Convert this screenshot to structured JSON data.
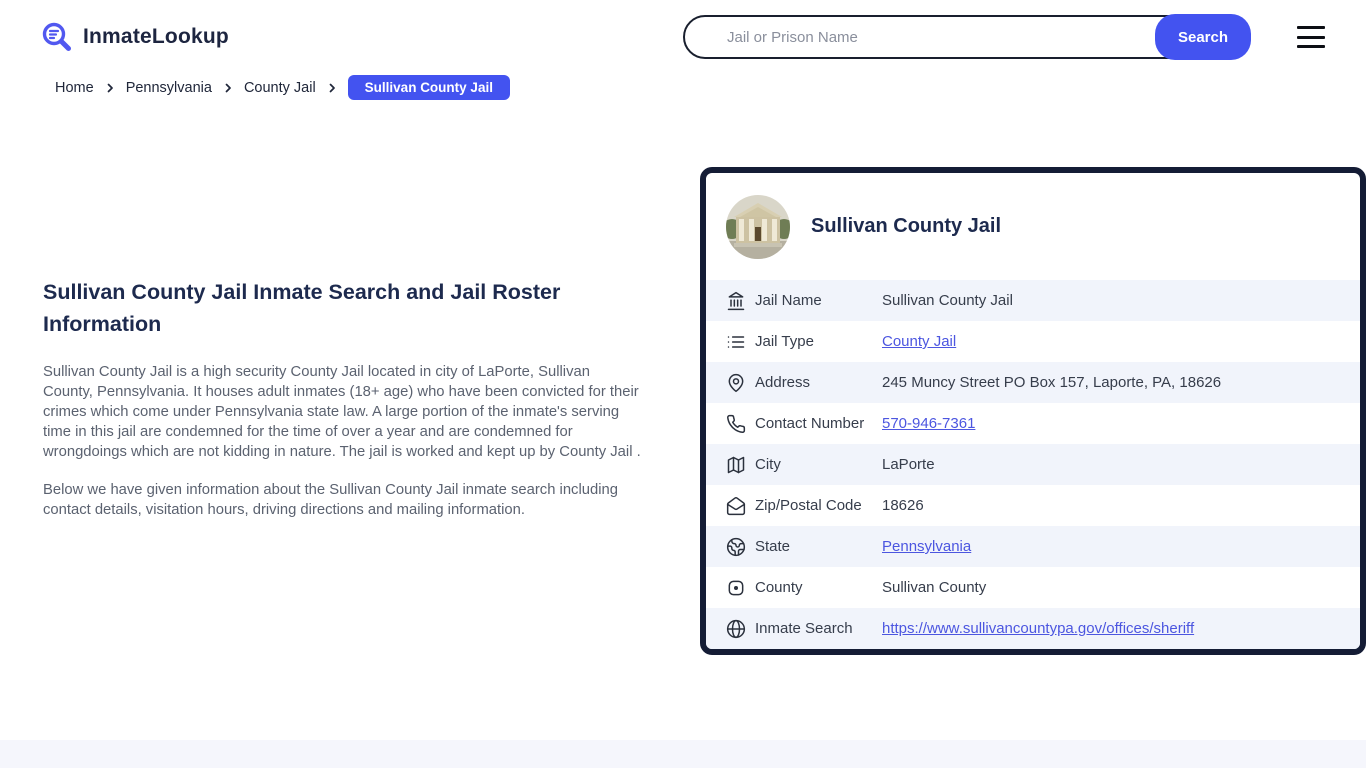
{
  "header": {
    "logo_text": "InmateLookup",
    "search": {
      "placeholder": "Jail or Prison Name",
      "button_label": "Search"
    }
  },
  "breadcrumb": {
    "items": [
      "Home",
      "Pennsylvania",
      "County Jail"
    ],
    "current": "Sullivan County Jail"
  },
  "article": {
    "title": "Sullivan County Jail Inmate Search and Jail Roster Information",
    "paragraphs": [
      "Sullivan County Jail is a high security County Jail located in city of LaPorte, Sullivan County, Pennsylvania. It houses adult inmates (18+ age) who have been convicted for their crimes which come under Pennsylvania state law. A large portion of the inmate's serving time in this jail are condemned for the time of over a year and are condemned for wrongdoings which are not kidding in nature. The jail is worked and kept up by County Jail .",
      "Below we have given information about the Sullivan County Jail inmate search including contact details, visitation hours, driving directions and mailing information."
    ]
  },
  "card": {
    "title": "Sullivan County Jail",
    "rows": [
      {
        "icon": "landmark-icon",
        "label": "Jail Name",
        "value": "Sullivan County Jail"
      },
      {
        "icon": "list-icon",
        "label": "Jail Type",
        "value": "County Jail"
      },
      {
        "icon": "map-pin-icon",
        "label": "Address",
        "value": "245 Muncy Street PO Box 157, Laporte, PA, 18626"
      },
      {
        "icon": "phone-icon",
        "label": "Contact Number",
        "value": "570-946-7361"
      },
      {
        "icon": "map-icon",
        "label": "City",
        "value": "LaPorte"
      },
      {
        "icon": "mail-icon",
        "label": "Zip/Postal Code",
        "value": "18626"
      },
      {
        "icon": "earth-icon",
        "label": "State",
        "value": "Pennsylvania"
      },
      {
        "icon": "county-icon",
        "label": "County",
        "value": "Sullivan County"
      },
      {
        "icon": "globe-icon",
        "label": "Inmate Search",
        "value": "https://www.sullivancountypa.gov/offices/sheriff"
      }
    ]
  },
  "colors": {
    "accent": "#4353f0",
    "navy": "#141c35",
    "link": "#4c56e0",
    "row_alt": "#f1f4fb",
    "bottom_strip": "#f5f6fc"
  }
}
